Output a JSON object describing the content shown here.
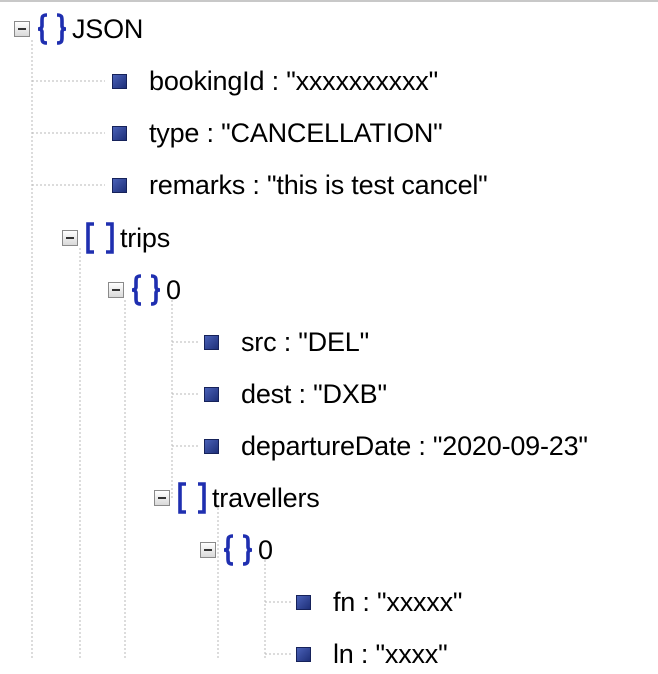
{
  "tree": {
    "root": {
      "label": "JSON",
      "type": "object"
    },
    "root_fields": [
      {
        "text": "bookingId : \"xxxxxxxxxx\""
      },
      {
        "text": "type : \"CANCELLATION\""
      },
      {
        "text": "remarks : \"this is test cancel\""
      }
    ],
    "trips": {
      "label": "trips",
      "type": "array"
    },
    "trip_0": {
      "label": "0",
      "type": "object"
    },
    "trip_fields": [
      {
        "text": "src : \"DEL\""
      },
      {
        "text": "dest : \"DXB\""
      },
      {
        "text": "departureDate : \"2020-09-23\""
      }
    ],
    "travellers": {
      "label": "travellers",
      "type": "array"
    },
    "traveller_0": {
      "label": "0",
      "type": "object"
    },
    "traveller_fields": [
      {
        "text": "fn : \"xxxxx\""
      },
      {
        "text": "ln : \"xxxx\""
      }
    ]
  },
  "colors": {
    "brace": "#1f2fb0",
    "bullet": "#2b3d8f",
    "guide": "#b9b9b9",
    "toggle_border": "#8a8a8a"
  },
  "icons": {
    "collapse": "minus-box-icon",
    "object": "curly-braces-icon",
    "array": "square-brackets-icon",
    "leaf": "square-bullet-icon"
  }
}
